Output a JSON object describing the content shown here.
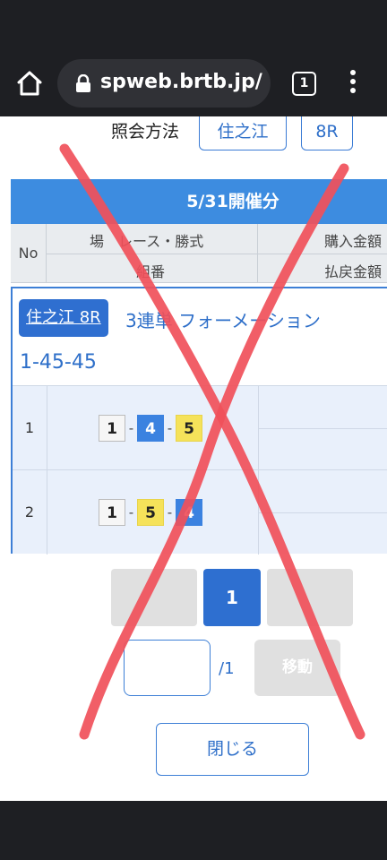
{
  "browser": {
    "url": "spweb.brtb.jp/",
    "tab_count": "1",
    "icons": {
      "home": "home-icon",
      "lock": "lock-icon",
      "tabs": "tabs-icon",
      "menu": "more-vert-icon"
    }
  },
  "query": {
    "label": "照会方法",
    "venue": "住之江",
    "race": "8R"
  },
  "table": {
    "date_title": "5/31開催分",
    "headers": {
      "no": "No",
      "venue_race_type": "場　レース・勝式",
      "purchase_amount": "購入金額",
      "combination": "組番",
      "payout_amount": "払戻金額"
    },
    "detail": {
      "tag": "住之江 8R",
      "bet_type": "3連単 フォーメーション",
      "combo": "1-45-45"
    },
    "rows": [
      {
        "no": "1",
        "boats": [
          "1",
          "4",
          "5"
        ]
      },
      {
        "no": "2",
        "boats": [
          "1",
          "5",
          "4"
        ]
      }
    ]
  },
  "pagination": {
    "current": "1",
    "input_value": "",
    "total": "/1",
    "move_label": "移動",
    "close_label": "閉じる"
  },
  "colors": {
    "accent": "#3d8ce0",
    "primary_button": "#2e6fd0",
    "boat_1": "#f6f6f6",
    "boat_4": "#3b82e0",
    "boat_5": "#f5e25a",
    "overlay_x": "#f0505a"
  }
}
